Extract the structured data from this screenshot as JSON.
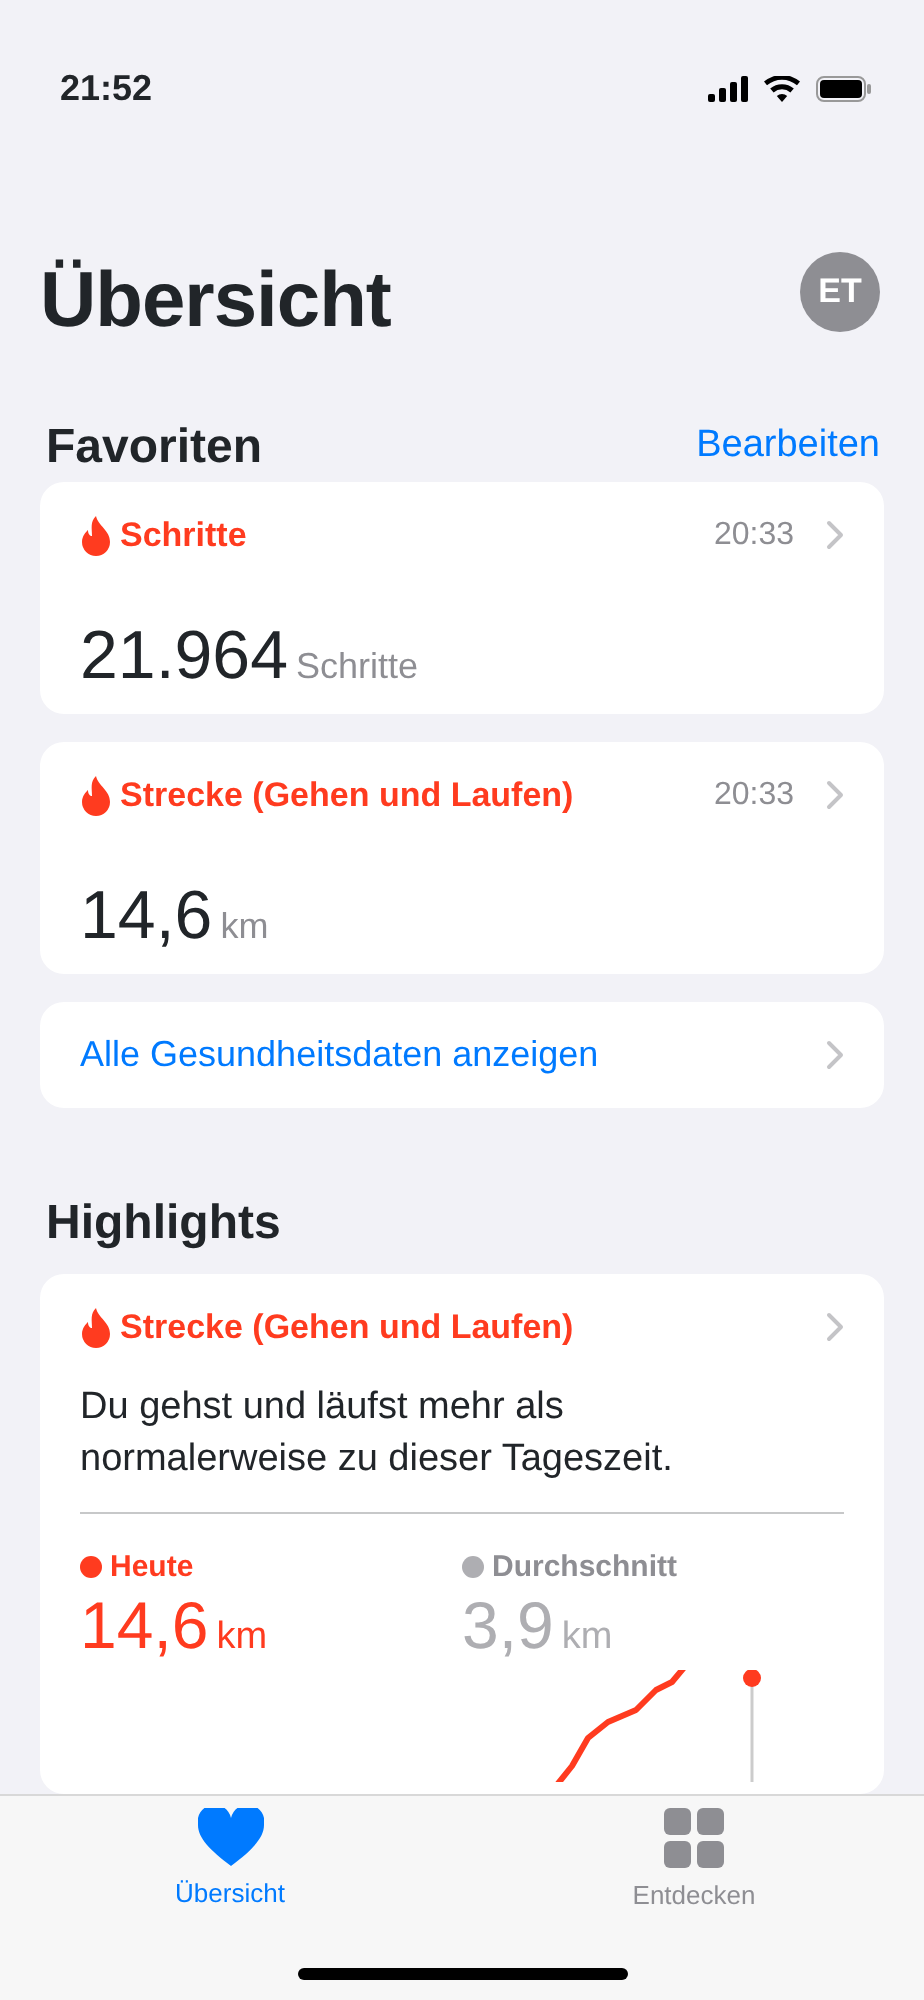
{
  "status_bar": {
    "time": "21:52"
  },
  "header": {
    "title": "Übersicht",
    "avatar": "ET"
  },
  "favorites": {
    "title": "Favoriten",
    "edit": "Bearbeiten",
    "items": [
      {
        "label": "Schritte",
        "time": "20:33",
        "value": "21.964",
        "unit": "Schritte"
      },
      {
        "label": "Strecke (Gehen und Laufen)",
        "time": "20:33",
        "value": "14,6",
        "unit": "km"
      }
    ]
  },
  "show_all": "Alle Gesundheitsdaten anzeigen",
  "highlights": {
    "title": "Highlights",
    "card": {
      "label": "Strecke (Gehen und Laufen)",
      "message": "Du gehst und läufst mehr als normalerweise zu dieser Tageszeit.",
      "legend": [
        {
          "label": "Heute",
          "value": "14,6",
          "unit": "km",
          "color": "#ff3b1f"
        },
        {
          "label": "Durchschnitt",
          "value": "3,9",
          "unit": "km",
          "color": "#aeaeb2"
        }
      ]
    }
  },
  "tabs": [
    {
      "label": "Übersicht",
      "selected": true,
      "kind": "heart"
    },
    {
      "label": "Entdecken",
      "selected": false,
      "kind": "grid"
    }
  ]
}
